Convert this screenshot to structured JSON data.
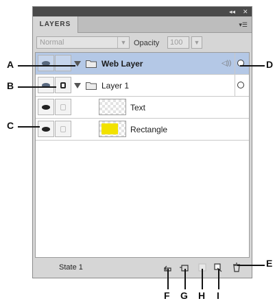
{
  "panel": {
    "tab_label": "LAYERS",
    "controls": [
      "◂◂",
      "✕"
    ],
    "menu_glyph": "▾☰"
  },
  "options": {
    "blend_mode": "Normal",
    "opacity_label": "Opacity",
    "opacity_value": "100"
  },
  "layers": [
    {
      "name": "Web Layer",
      "bold": true,
      "selected": true
    },
    {
      "name": "Layer 1",
      "bold": false,
      "selected": false
    },
    {
      "name": "Text",
      "bold": false,
      "selected": false
    },
    {
      "name": "Rectangle",
      "bold": false,
      "selected": false
    }
  ],
  "bottom": {
    "state_label": "State 1"
  },
  "callouts": {
    "A": "A",
    "B": "B",
    "C": "C",
    "D": "D",
    "E": "E",
    "F": "F",
    "G": "G",
    "H": "H",
    "I": "I"
  },
  "colors": {
    "selection": "#b4c8e6",
    "rectangle_fill": "#f2e200"
  }
}
